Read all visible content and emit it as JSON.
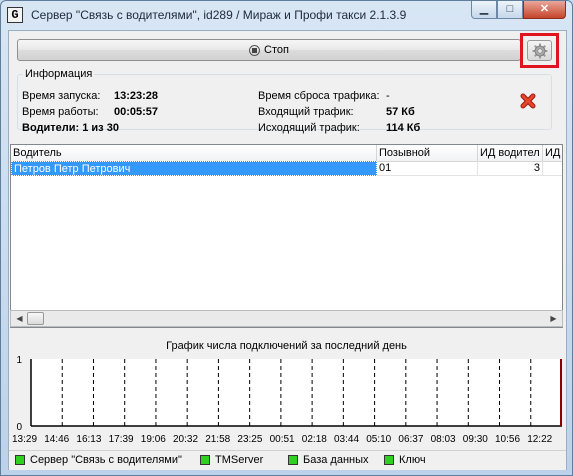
{
  "window": {
    "app_icon_letter": "G",
    "title": "Сервер \"Связь с водителями\", id289 / Мираж и Профи такси 2.1.3.9",
    "min_glyph": "▁",
    "max_glyph": "□",
    "close_glyph": "✕"
  },
  "toolbar": {
    "stop_label": "Стоп",
    "settings_icon": "gear-icon"
  },
  "info": {
    "legend": "Информация",
    "start_time_label": "Время запуска:",
    "start_time_value": "13:23:28",
    "uptime_label": "Время работы:",
    "uptime_value": "00:05:57",
    "drivers_label": "Водители: 1 из 30",
    "reset_label": "Время сброса трафика:",
    "reset_value": "-",
    "incoming_label": "Входящий трафик:",
    "incoming_value": "57 Кб",
    "outgoing_label": "Исходящий трафик:",
    "outgoing_value": "114 Кб",
    "reset_button_icon": "red-x-icon"
  },
  "table": {
    "columns": [
      "Водитель",
      "Позывной",
      "ИД водител",
      "ИД з"
    ],
    "rows": [
      {
        "driver": "Петров Петр Петрович",
        "callsign": "01",
        "driver_id": "3",
        "extra": ""
      }
    ]
  },
  "scrollbar": {
    "left_arrow": "◀",
    "right_arrow": "▶"
  },
  "chart_data": {
    "type": "line",
    "title": "График числа подключений за последний день",
    "x": [
      "13:29",
      "14:46",
      "16:13",
      "17:39",
      "19:06",
      "20:32",
      "21:58",
      "23:25",
      "00:51",
      "02:18",
      "03:44",
      "05:10",
      "06:37",
      "08:03",
      "09:30",
      "10:56",
      "12:22"
    ],
    "ylim": [
      0,
      1
    ],
    "y_ticks": [
      "1",
      "0"
    ],
    "series": [
      {
        "values": [
          0,
          0,
          0,
          0,
          0,
          0,
          0,
          0,
          0,
          0,
          0,
          0,
          0,
          0,
          0,
          0,
          1
        ]
      }
    ],
    "grid": true,
    "colors": {
      "background": "#ffffff",
      "grid": "#000000",
      "end_marker": "#8b0000"
    }
  },
  "status": {
    "items": [
      {
        "label": "Сервер \"Связь с водителями\"",
        "color": "#2fd11f"
      },
      {
        "label": "TMServer",
        "color": "#2fd11f"
      },
      {
        "label": "База данных",
        "color": "#2fd11f"
      },
      {
        "label": "Ключ",
        "color": "#2fd11f"
      }
    ]
  }
}
